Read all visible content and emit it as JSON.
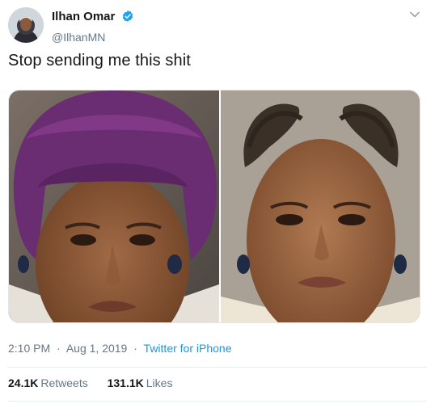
{
  "author": {
    "display_name": "Ilhan Omar",
    "handle": "@IlhanMN"
  },
  "tweet": {
    "text": "Stop sending me this shit",
    "time": "2:10 PM",
    "date": "Aug 1, 2019",
    "source": "Twitter for iPhone",
    "separator": "·"
  },
  "stats": {
    "retweets_count": "24.1K",
    "retweets_label": "Retweets",
    "likes_count": "131.1K",
    "likes_label": "Likes"
  },
  "colors": {
    "link": "#1b95e0",
    "verified": "#1da1f2",
    "muted": "#657786"
  },
  "icons": {
    "verified": "verified-badge-icon",
    "caret": "chevron-down-icon"
  }
}
